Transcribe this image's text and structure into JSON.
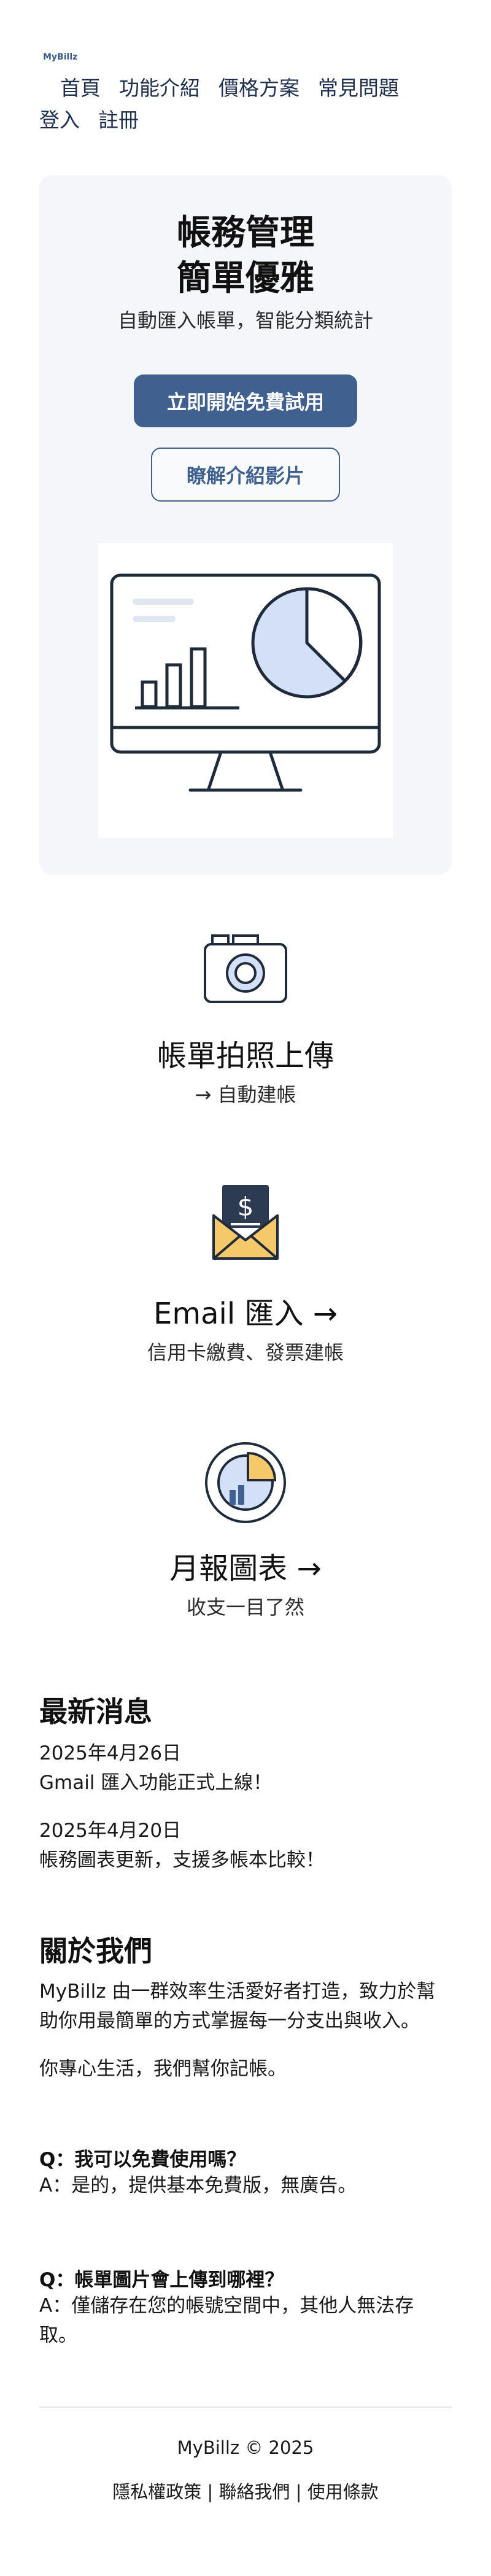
{
  "brand": {
    "logo": "MyBillz"
  },
  "nav": {
    "items": [
      "首頁",
      "功能介紹",
      "價格方案",
      "常見問題",
      "登入",
      "註冊"
    ]
  },
  "hero": {
    "title_line1": "帳務管理",
    "title_line2": "簡單優雅",
    "subtitle": "自動匯入帳單，智能分類統計",
    "cta_primary": "立即開始免費試用",
    "cta_secondary": "瞭解介紹影片"
  },
  "features": [
    {
      "icon": "camera-icon",
      "title": "帳單拍照上傳",
      "desc": "→ 自動建帳"
    },
    {
      "icon": "email-dollar-icon",
      "title": "Email 匯入 →",
      "desc": "信用卡繳費、發票建帳"
    },
    {
      "icon": "pie-chart-icon",
      "title": "月報圖表 →",
      "desc": "收支一目了然"
    }
  ],
  "news": {
    "title": "最新消息",
    "items": [
      {
        "date": "2025年4月26日",
        "text": "Gmail 匯入功能正式上線！"
      },
      {
        "date": "2025年4月20日",
        "text": "帳務圖表更新，支援多帳本比較！"
      }
    ]
  },
  "about": {
    "title": "關於我們",
    "p1": "MyBillz 由一群效率生活愛好者打造，致力於幫助你用最簡單的方式掌握每一分支出與收入。",
    "p2": "你專心生活，我們幫你記帳。"
  },
  "faq": [
    {
      "q": "Q：我可以免費使用嗎？",
      "a": "A：是的，提供基本免費版，無廣告。"
    },
    {
      "q": "Q：帳單圖片會上傳到哪裡？",
      "a": "A：僅儲存在您的帳號空間中，其他人無法存取。"
    }
  ],
  "footer": {
    "copyright": "MyBillz © 2025",
    "links": [
      "隱私權政策",
      "聯絡我們",
      "使用條款"
    ],
    "separator": " | "
  },
  "colors": {
    "accent": "#40608f",
    "hero_bg": "#f4f6f9",
    "pie_fill": "#d3e0f7",
    "envelope": "#f5c86a",
    "outline": "#1f2a3a"
  }
}
